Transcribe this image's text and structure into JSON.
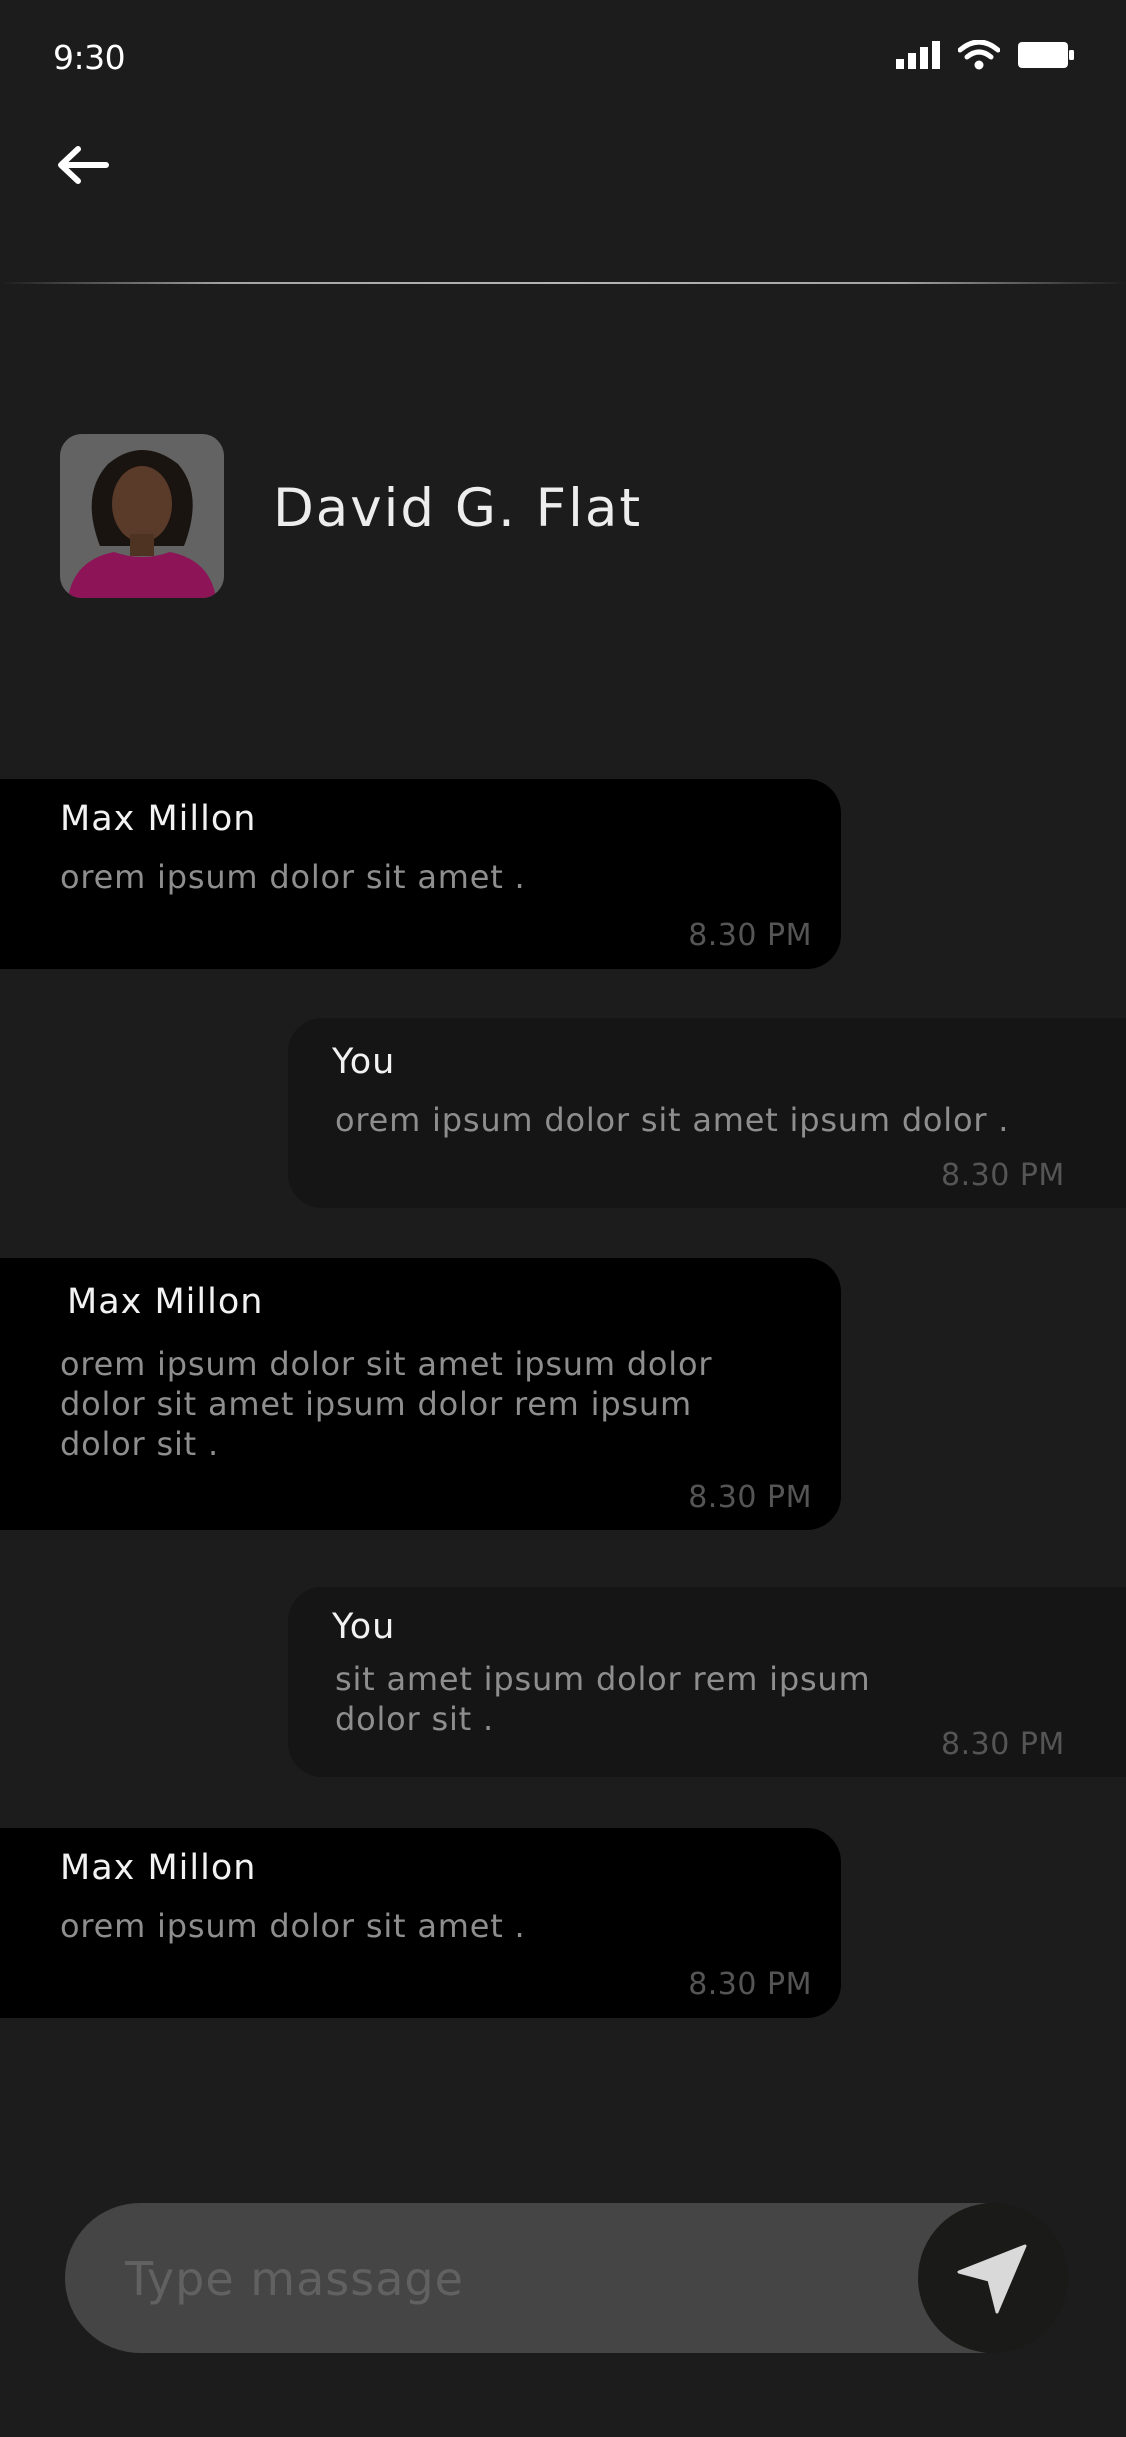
{
  "status_bar": {
    "time": "9:30"
  },
  "contact": {
    "name": "David G. Flat"
  },
  "messages": [
    {
      "sender": "Max Millon",
      "text": "orem ipsum dolor sit amet .",
      "time": "8.30 PM"
    },
    {
      "sender": "You",
      "text": "orem ipsum dolor sit amet  ipsum dolor .",
      "time": "8.30 PM"
    },
    {
      "sender": "Max Millon",
      "text": "orem ipsum dolor sit amet  ipsum dolor dolor sit amet  ipsum dolor rem ipsum dolor sit .",
      "time": "8.30 PM"
    },
    {
      "sender": "You",
      "text": "sit amet  ipsum dolor rem ipsum dolor sit .",
      "time": "8.30 PM"
    },
    {
      "sender": "Max Millon",
      "text": "orem ipsum dolor sit amet .",
      "time": "8.30 PM"
    }
  ],
  "composer": {
    "placeholder": "Type massage"
  },
  "icons": {
    "back": "arrow-left-icon",
    "send": "send-icon",
    "signal": "signal-icon",
    "wifi": "wifi-icon",
    "battery": "battery-icon"
  },
  "colors": {
    "background": "#1c1c1d",
    "incoming_bubble": "#000000",
    "outgoing_bubble": "#161516",
    "input_bar": "#454545"
  }
}
